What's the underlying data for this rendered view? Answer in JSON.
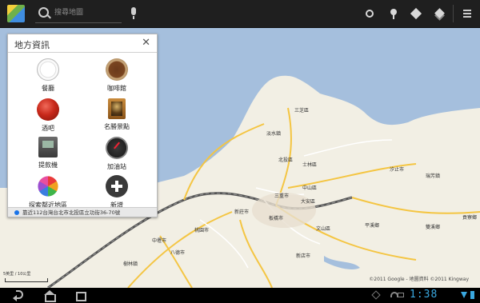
{
  "search": {
    "placeholder": "搜尋地圖"
  },
  "toolbar": {
    "icons": [
      "my-location-icon",
      "places-pin-icon",
      "directions-icon",
      "layers-icon",
      "menu-icon"
    ]
  },
  "panel": {
    "title": "地方資訊",
    "items": [
      {
        "label": "餐廳",
        "icon": "restaurant-icon"
      },
      {
        "label": "咖啡館",
        "icon": "cafe-icon"
      },
      {
        "label": "酒吧",
        "icon": "bar-icon"
      },
      {
        "label": "名勝景點",
        "icon": "attraction-icon"
      },
      {
        "label": "提款機",
        "icon": "atm-icon"
      },
      {
        "label": "加油站",
        "icon": "gas-station-icon"
      },
      {
        "label": "探索鄰近地區",
        "icon": "explore-icon"
      },
      {
        "label": "新增",
        "icon": "add-icon"
      }
    ],
    "footer": "靠近112台灣台北市北投區立功街36-70號"
  },
  "map": {
    "labels": [
      "三芝區",
      "淡水鎮",
      "北投區",
      "士林區",
      "中山區",
      "三重市",
      "大安區",
      "板橋市",
      "文山區",
      "新莊市",
      "汐止市",
      "瑞芳鎮",
      "貢寮鄉",
      "雙溪鄉",
      "樹林鎮",
      "中壢市",
      "八德市",
      "桃園市",
      "平溪鄉",
      "新店市"
    ],
    "copyright": "©2011 Google - 地圖資料 ©2011 Kingway",
    "scale": "5英里 / 10公里"
  },
  "status": {
    "clock": "1:38"
  },
  "colors": {
    "topbar": "#1f1f1f",
    "map_land": "#f2efe4",
    "water": "#a5bfdd",
    "clock": "#3aa8e0"
  }
}
